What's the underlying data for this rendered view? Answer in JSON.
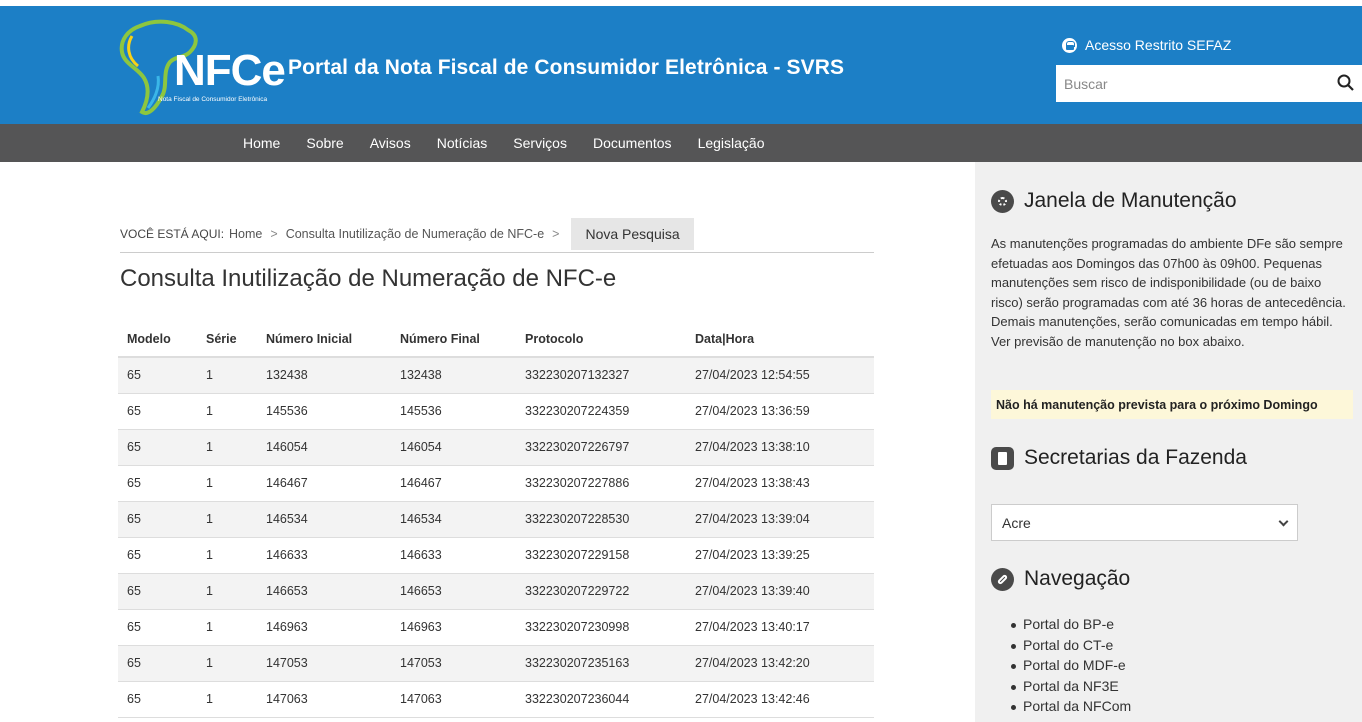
{
  "header": {
    "logo_text": "NFCe",
    "logo_subtitle": "Nota Fiscal de Consumidor Eletrônica",
    "title": "Portal da Nota Fiscal de Consumidor Eletrônica - SVRS",
    "restricted_access": "Acesso Restrito SEFAZ",
    "search_placeholder": "Buscar",
    "colors": {
      "header_bg": "#1c7fc6",
      "nav_bg": "#555556"
    }
  },
  "nav": {
    "items": [
      {
        "label": "Home"
      },
      {
        "label": "Sobre"
      },
      {
        "label": "Avisos"
      },
      {
        "label": "Notícias"
      },
      {
        "label": "Serviços"
      },
      {
        "label": "Documentos"
      },
      {
        "label": "Legislação"
      }
    ]
  },
  "breadcrumb": {
    "label": "VOCÊ ESTÁ AQUI:",
    "home": "Home",
    "current": "Consulta Inutilização de Numeração de NFC-e",
    "separator": ">",
    "new_search": "Nova Pesquisa"
  },
  "page": {
    "title": "Consulta Inutilização de Numeração de NFC-e"
  },
  "table": {
    "columns": [
      "Modelo",
      "Série",
      "Número Inicial",
      "Número Final",
      "Protocolo",
      "Data|Hora"
    ],
    "rows": [
      [
        "65",
        "1",
        "132438",
        "132438",
        "332230207132327",
        "27/04/2023 12:54:55"
      ],
      [
        "65",
        "1",
        "145536",
        "145536",
        "332230207224359",
        "27/04/2023 13:36:59"
      ],
      [
        "65",
        "1",
        "146054",
        "146054",
        "332230207226797",
        "27/04/2023 13:38:10"
      ],
      [
        "65",
        "1",
        "146467",
        "146467",
        "332230207227886",
        "27/04/2023 13:38:43"
      ],
      [
        "65",
        "1",
        "146534",
        "146534",
        "332230207228530",
        "27/04/2023 13:39:04"
      ],
      [
        "65",
        "1",
        "146633",
        "146633",
        "332230207229158",
        "27/04/2023 13:39:25"
      ],
      [
        "65",
        "1",
        "146653",
        "146653",
        "332230207229722",
        "27/04/2023 13:39:40"
      ],
      [
        "65",
        "1",
        "146963",
        "146963",
        "332230207230998",
        "27/04/2023 13:40:17"
      ],
      [
        "65",
        "1",
        "147053",
        "147053",
        "332230207235163",
        "27/04/2023 13:42:20"
      ],
      [
        "65",
        "1",
        "147063",
        "147063",
        "332230207236044",
        "27/04/2023 13:42:46"
      ]
    ]
  },
  "sidebar": {
    "maintenance": {
      "heading": "Janela de Manutenção",
      "icon": "gear-icon",
      "text": "As manutenções programadas do ambiente DFe são sempre efetuadas aos Domingos das 07h00 às 09h00. Pequenas manutenções sem risco de indisponibilidade (ou de baixo risco) serão programadas com até 36 horas de antecedência. Demais manutenções, serão comunicadas em tempo hábil. Ver previsão de manutenção no box abaixo.",
      "notice": "Não há manutenção prevista para o próximo Domingo"
    },
    "secretarias": {
      "heading": "Secretarias da Fazenda",
      "icon": "book-icon",
      "selected": "Acre"
    },
    "navegacao": {
      "heading": "Navegação",
      "icon": "link-icon",
      "links": [
        "Portal do BP-e",
        "Portal do CT-e",
        "Portal do MDF-e",
        "Portal da NF3E",
        "Portal da NFCom"
      ]
    }
  }
}
